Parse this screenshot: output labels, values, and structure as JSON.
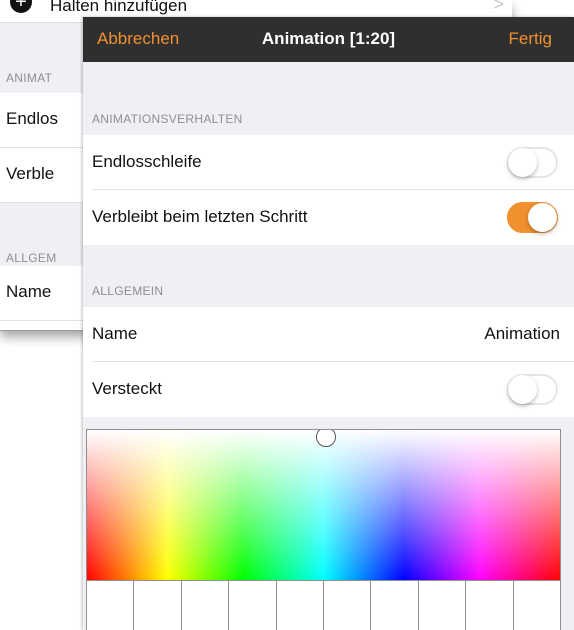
{
  "background_panel": {
    "top_row_label": "Halten hinzufügen",
    "section1_header": "ANIMAT",
    "cell1_label": "Endlos",
    "cell2_label": "Verble",
    "section2_header": "ALLGEM",
    "cell3_label": "Name"
  },
  "navbar": {
    "cancel_label": "Abbrechen",
    "title": "Animation [1:20]",
    "done_label": "Fertig"
  },
  "sections": {
    "animation_header": "ANIMATIONSVERHALTEN",
    "loop_label": "Endlosschleife",
    "loop_on": false,
    "stay_last_label": "Verbleibt beim letzten Schritt",
    "stay_last_on": true,
    "general_header": "ALLGEMEIN",
    "name_label": "Name",
    "name_value": "Animation",
    "hidden_label": "Versteckt",
    "hidden_on": false
  },
  "colors": {
    "accent": "#f0902e",
    "navbar_bg": "#2f2f2f",
    "group_bg": "#efeff4",
    "section_header_text": "#8e8e93"
  },
  "color_picker": {
    "swatch_count": 10
  }
}
